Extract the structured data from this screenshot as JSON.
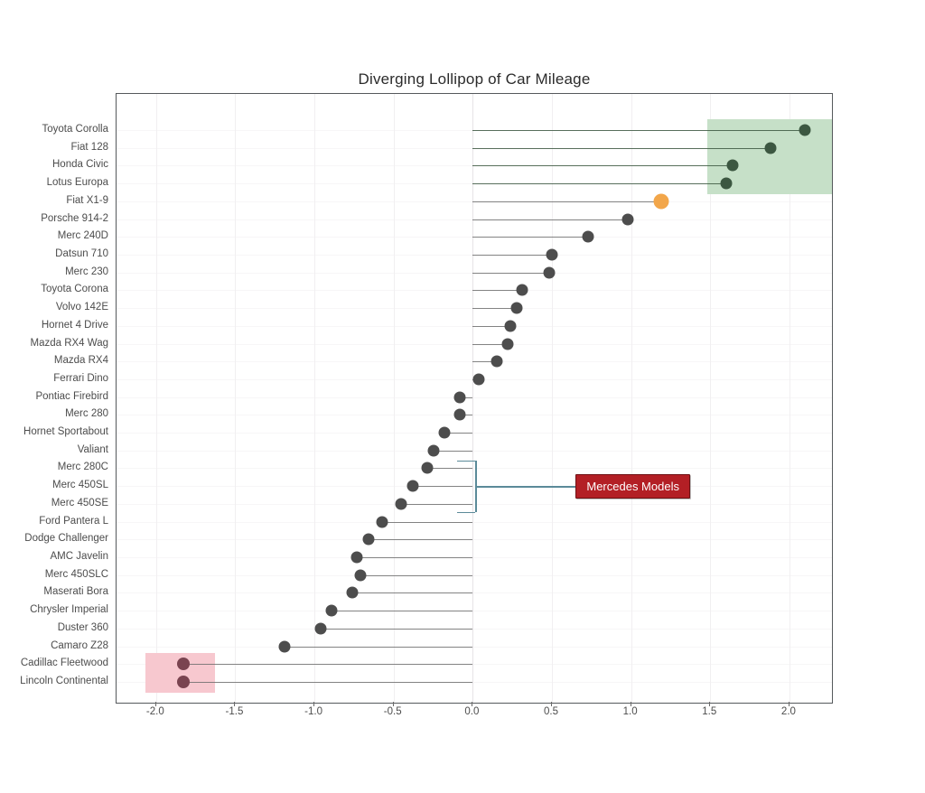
{
  "chart_data": {
    "type": "scatter",
    "subtype": "diverging-lollipop",
    "title": "Diverging Lollipop of Car Mileage",
    "xlabel": "",
    "ylabel": "",
    "xlim": [
      -2.25,
      2.28
    ],
    "ylim_categories_count": 32,
    "grid": true,
    "legend": "none",
    "xticks": [
      "-2.0",
      "-1.5",
      "-1.0",
      "-0.5",
      "0.0",
      "0.5",
      "1.0",
      "1.5",
      "2.0"
    ],
    "xtick_values": [
      -2.0,
      -1.5,
      -1.0,
      -0.5,
      0.0,
      0.5,
      1.0,
      1.5,
      2.0
    ],
    "categories": [
      "Toyota Corolla",
      "Fiat 128",
      "Honda Civic",
      "Lotus Europa",
      "Fiat X1-9",
      "Porsche 914-2",
      "Merc 240D",
      "Datsun 710",
      "Merc 230",
      "Toyota Corona",
      "Volvo 142E",
      "Hornet 4 Drive",
      "Mazda RX4 Wag",
      "Mazda RX4",
      "Ferrari Dino",
      "Pontiac Firebird",
      "Merc 280",
      "Hornet Sportabout",
      "Valiant",
      "Merc 280C",
      "Merc 450SL",
      "Merc 450SE",
      "Ford Pantera L",
      "Dodge Challenger",
      "AMC Javelin",
      "Merc 450SLC",
      "Maserati Bora",
      "Chrysler Imperial",
      "Duster 360",
      "Camaro Z28",
      "Cadillac Fleetwood",
      "Lincoln Continental"
    ],
    "values": [
      2.1,
      1.88,
      1.64,
      1.6,
      1.19,
      0.98,
      0.73,
      0.5,
      0.48,
      0.31,
      0.28,
      0.24,
      0.22,
      0.15,
      0.04,
      -0.08,
      -0.08,
      -0.18,
      -0.25,
      -0.29,
      -0.38,
      -0.45,
      -0.57,
      -0.66,
      -0.73,
      -0.71,
      -0.76,
      -0.89,
      -0.96,
      -1.19,
      -1.83,
      -1.83
    ],
    "colors": {
      "dot_default": "#4d4d4d",
      "dot_highlight_positive": "#3c5741",
      "dot_highlight_negative": "#7a4450",
      "dot_accent_orange": "#f2a64a",
      "stem": "#6f6f6f",
      "band_green": "#c6e0c8",
      "band_pink": "#f7c8cf",
      "annotation_fill": "#b31f25",
      "annotation_border": "#6e1013",
      "annotation_text": "#ffffff",
      "annotation_leader": "#5b8a99",
      "axis": "#55595c",
      "tick_text": "#4c4c4c",
      "title_text": "#2b2b2b",
      "grid": "#f1eff1"
    },
    "point_styles": [
      {
        "category": "Toyota Corolla",
        "color": "#3c5741",
        "size": 13,
        "highlighted": true
      },
      {
        "category": "Fiat 128",
        "color": "#3c5741",
        "size": 13,
        "highlighted": true
      },
      {
        "category": "Honda Civic",
        "color": "#3c5741",
        "size": 13,
        "highlighted": true
      },
      {
        "category": "Lotus Europa",
        "color": "#3c5741",
        "size": 13,
        "highlighted": true
      },
      {
        "category": "Fiat X1-9",
        "color": "#f2a64a",
        "size": 17,
        "highlighted": true
      },
      {
        "category": "Cadillac Fleetwood",
        "color": "#7a4450",
        "size": 14,
        "highlighted": true
      },
      {
        "category": "Lincoln Continental",
        "color": "#7a4450",
        "size": 14,
        "highlighted": true
      }
    ],
    "highlight_bands": [
      {
        "name": "top-performers",
        "color": "#c6e0c8",
        "x_range": [
          1.48,
          2.28
        ],
        "categories": [
          "Toyota Corolla",
          "Fiat 128",
          "Honda Civic",
          "Lotus Europa"
        ]
      },
      {
        "name": "bottom-performers",
        "color": "#f7c8cf",
        "x_range": [
          -2.07,
          -1.63
        ],
        "categories": [
          "Cadillac Fleetwood",
          "Lincoln Continental"
        ]
      }
    ],
    "annotations": [
      {
        "text": "Mercedes Models",
        "target_categories": [
          "Merc 280C",
          "Merc 450SL",
          "Merc 450SE"
        ],
        "style": "brace-with-label",
        "fill": "#b31f25",
        "border": "#6e1013",
        "text_color": "#ffffff",
        "leader_color": "#5b8a99"
      }
    ]
  },
  "title": "Diverging Lollipop of Car Mileage",
  "annotation": {
    "label": "Mercedes Models"
  }
}
